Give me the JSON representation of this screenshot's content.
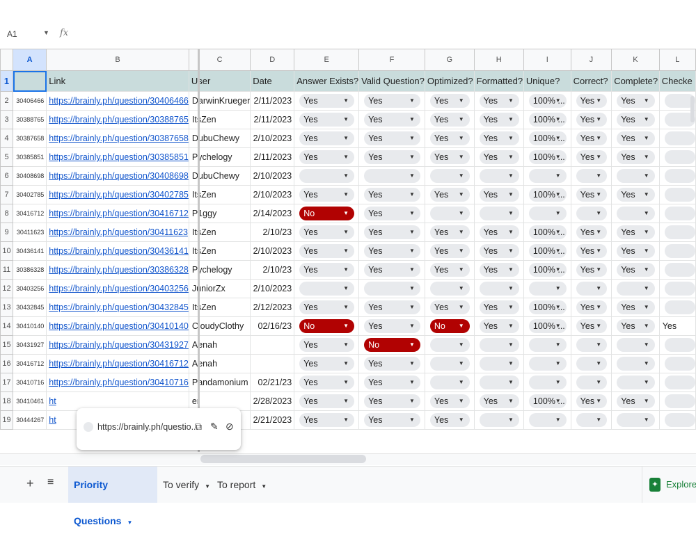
{
  "formula_bar": {
    "cell_ref": "A1",
    "fx": "fx"
  },
  "column_letters": [
    "A",
    "B",
    "C",
    "D",
    "E",
    "F",
    "G",
    "H",
    "I",
    "J",
    "K",
    "L"
  ],
  "header_row": {
    "row_number": "1",
    "cells": [
      "",
      "Link",
      "User",
      "Date",
      "Answer Exists?",
      "Valid Question?",
      "Optimized?",
      "Formatted?",
      "Unique?",
      "Correct?",
      "Complete?",
      "Checke"
    ]
  },
  "rows": [
    {
      "n": "2",
      "id": "30406466",
      "link": "https://brainly.ph/question/30406466",
      "user": "DarwinKrueger",
      "date": "2/11/2023",
      "e": "Yes",
      "f": "Yes",
      "g": "Yes",
      "h": "Yes",
      "i": "100% ...",
      "j": "Yes",
      "k": "Yes",
      "l": ""
    },
    {
      "n": "3",
      "id": "30388765",
      "link": "https://brainly.ph/question/30388765",
      "user": "ItsZen",
      "date": "2/11/2023",
      "e": "Yes",
      "f": "Yes",
      "g": "Yes",
      "h": "Yes",
      "i": "100% ...",
      "j": "Yes",
      "k": "Yes",
      "l": ""
    },
    {
      "n": "4",
      "id": "30387658",
      "link": "https://brainly.ph/question/30387658",
      "user": "DubuChewy",
      "date": "2/10/2023",
      "e": "Yes",
      "f": "Yes",
      "g": "Yes",
      "h": "Yes",
      "i": "100% ...",
      "j": "Yes",
      "k": "Yes",
      "l": ""
    },
    {
      "n": "5",
      "id": "30385851",
      "link": "https://brainly.ph/question/30385851",
      "user": "Pychelogy",
      "date": "2/11/2023",
      "e": "Yes",
      "f": "Yes",
      "g": "Yes",
      "h": "Yes",
      "i": "100% ...",
      "j": "Yes",
      "k": "Yes",
      "l": ""
    },
    {
      "n": "6",
      "id": "30408698",
      "link": "https://brainly.ph/question/30408698",
      "user": "DubuChewy",
      "date": "2/10/2023",
      "e": "",
      "f": "",
      "g": "",
      "h": "",
      "i": "",
      "j": "",
      "k": "",
      "l": ""
    },
    {
      "n": "7",
      "id": "30402785",
      "link": "https://brainly.ph/question/30402785",
      "user": "ItsZen",
      "date": "2/10/2023",
      "e": "Yes",
      "f": "Yes",
      "g": "Yes",
      "h": "Yes",
      "i": "100% ...",
      "j": "Yes",
      "k": "Yes",
      "l": ""
    },
    {
      "n": "8",
      "id": "30416712",
      "link": "https://brainly.ph/question/30416712",
      "user": "P1ggy",
      "date": "2/14/2023",
      "e": "No",
      "f": "Yes",
      "g": "",
      "h": "",
      "i": "",
      "j": "",
      "k": "",
      "l": ""
    },
    {
      "n": "9",
      "id": "30411623",
      "link": "https://brainly.ph/question/30411623",
      "user": "ItsZen",
      "date": "2/10/23",
      "e": "Yes",
      "f": "Yes",
      "g": "Yes",
      "h": "Yes",
      "i": "100% ...",
      "j": "Yes",
      "k": "Yes",
      "l": ""
    },
    {
      "n": "10",
      "id": "30436141",
      "link": "https://brainly.ph/question/30436141",
      "user": "ItsZen",
      "date": "2/10/2023",
      "e": "Yes",
      "f": "Yes",
      "g": "Yes",
      "h": "Yes",
      "i": "100% ...",
      "j": "Yes",
      "k": "Yes",
      "l": ""
    },
    {
      "n": "11",
      "id": "30386328",
      "link": "https://brainly.ph/question/30386328",
      "user": "Pychelogy",
      "date": "2/10/23",
      "e": "Yes",
      "f": "Yes",
      "g": "Yes",
      "h": "Yes",
      "i": "100% ...",
      "j": "Yes",
      "k": "Yes",
      "l": ""
    },
    {
      "n": "12",
      "id": "30403256",
      "link": "https://brainly.ph/question/30403256",
      "user": "JuniorZx",
      "date": "2/10/2023",
      "e": "",
      "f": "",
      "g": "",
      "h": "",
      "i": "",
      "j": "",
      "k": "",
      "l": ""
    },
    {
      "n": "13",
      "id": "30432845",
      "link": "https://brainly.ph/question/30432845",
      "user": "ItsZen",
      "date": "2/12/2023",
      "e": "Yes",
      "f": "Yes",
      "g": "Yes",
      "h": "Yes",
      "i": "100% ...",
      "j": "Yes",
      "k": "Yes",
      "l": ""
    },
    {
      "n": "14",
      "id": "30410140",
      "link": "https://brainly.ph/question/30410140",
      "user": "CloudyClothy",
      "date": "02/16/23",
      "e": "No",
      "f": "Yes",
      "g": "No",
      "h": "Yes",
      "i": "100% ...",
      "j": "Yes",
      "k": "Yes",
      "l": "Yes"
    },
    {
      "n": "15",
      "id": "30431927",
      "link": "https://brainly.ph/question/30431927",
      "user": "Aenah",
      "date": "",
      "e": "Yes",
      "f": "No",
      "g": "",
      "h": "",
      "i": "",
      "j": "",
      "k": "",
      "l": ""
    },
    {
      "n": "16",
      "id": "30416712",
      "link": "https://brainly.ph/question/30416712",
      "user": "Aenah",
      "date": "",
      "e": "Yes",
      "f": "Yes",
      "g": "",
      "h": "",
      "i": "",
      "j": "",
      "k": "",
      "l": ""
    },
    {
      "n": "17",
      "id": "30410716",
      "link": "https://brainly.ph/question/30410716",
      "user": "Pandamonium",
      "date": "02/21/23",
      "e": "Yes",
      "f": "Yes",
      "g": "",
      "h": "",
      "i": "",
      "j": "",
      "k": "",
      "l": ""
    },
    {
      "n": "18",
      "id": "30410461",
      "link": "ht",
      "user": "er",
      "date": "2/28/2023",
      "e": "Yes",
      "f": "Yes",
      "g": "Yes",
      "h": "Yes",
      "i": "100% ...",
      "j": "Yes",
      "k": "Yes",
      "l": ""
    },
    {
      "n": "19",
      "id": "30444267",
      "link": "ht",
      "user": "",
      "date": "2/21/2023",
      "e": "Yes",
      "f": "Yes",
      "g": "Yes",
      "h": "",
      "i": "",
      "j": "",
      "k": "",
      "l": ""
    }
  ],
  "link_tooltip": {
    "url": "https://brainly.ph/questio...",
    "copy_icon": "copy-icon",
    "edit_icon": "pencil-icon",
    "unlink_icon": "unlink-icon"
  },
  "sheet_tabs": [
    {
      "label": "Priority Questions",
      "active": true
    },
    {
      "label": "To verify",
      "active": false
    },
    {
      "label": "To report",
      "active": false
    }
  ],
  "explore": {
    "label": "Explore"
  },
  "colors": {
    "no_chip": "#b10202",
    "header_fill": "#c9dcdc",
    "link": "#1155cc",
    "active_tab": "#0b57d0"
  }
}
